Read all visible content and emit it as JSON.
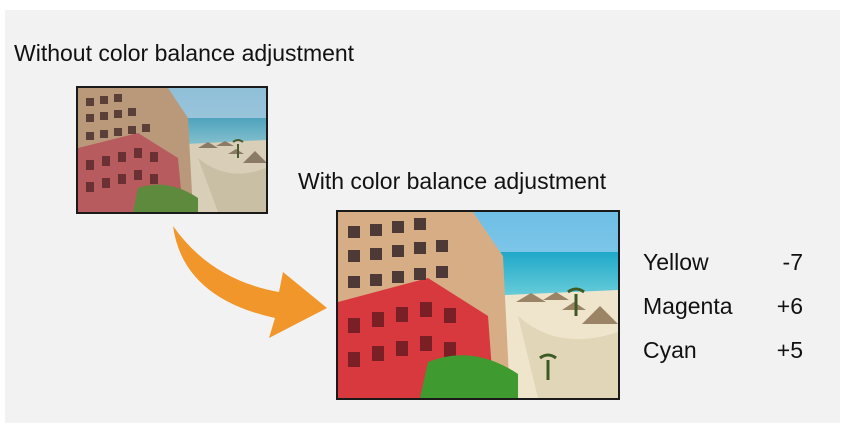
{
  "captions": {
    "before": "Without color balance adjustment",
    "after": "With color balance adjustment"
  },
  "images": {
    "before": {
      "description_icon": "hotel-beach-photo-unadjusted"
    },
    "after": {
      "description_icon": "hotel-beach-photo-adjusted"
    }
  },
  "arrow": {
    "icon": "curved-arrow-icon",
    "color": "#f0962a"
  },
  "settings": [
    {
      "label": "Yellow",
      "value": "-7"
    },
    {
      "label": "Magenta",
      "value": "+6"
    },
    {
      "label": "Cyan",
      "value": "+5"
    }
  ],
  "colors": {
    "background": "#f2f2f2",
    "text": "#111111",
    "arrow": "#f0962a"
  }
}
